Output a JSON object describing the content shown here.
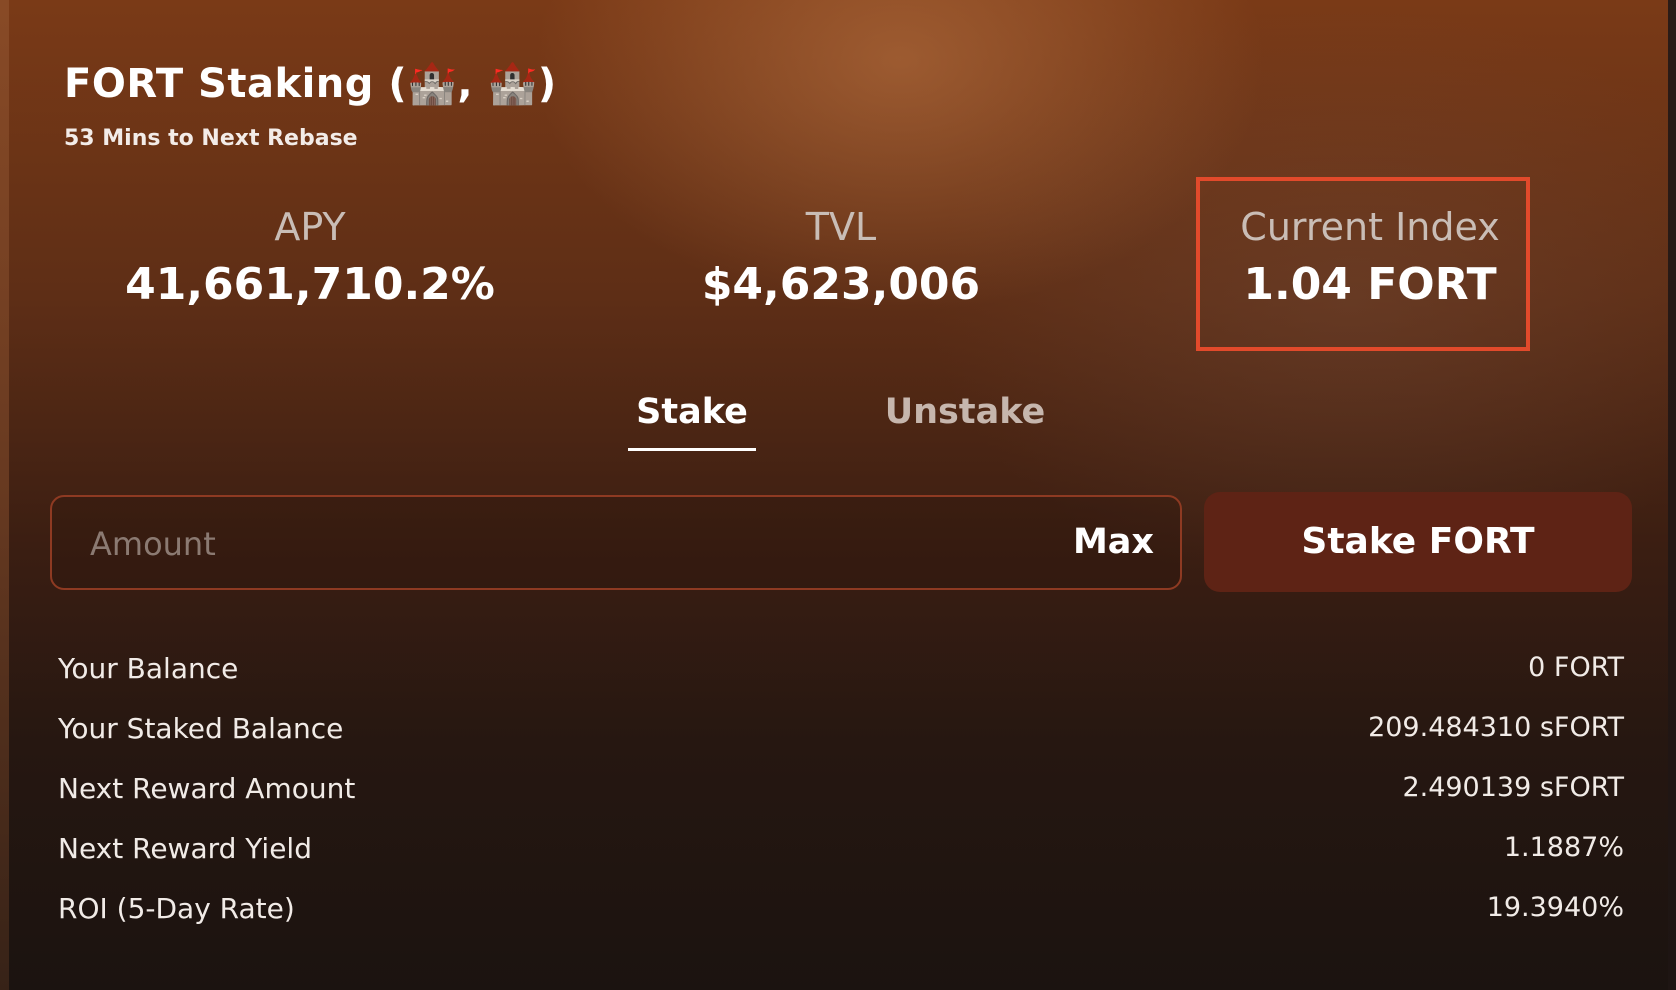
{
  "header": {
    "title": "FORT Staking (🏰, 🏰)",
    "rebase_text": "53 Mins to Next Rebase"
  },
  "stats": [
    {
      "label": "APY",
      "value": "41,661,710.2%"
    },
    {
      "label": "TVL",
      "value": "$4,623,006"
    },
    {
      "label": "Current Index",
      "value": "1.04 FORT"
    }
  ],
  "tabs": [
    {
      "label": "Stake",
      "active": true
    },
    {
      "label": "Unstake",
      "active": false
    }
  ],
  "amount": {
    "placeholder": "Amount",
    "value": "",
    "max_label": "Max"
  },
  "stake_button": {
    "label": "Stake FORT"
  },
  "details": [
    {
      "label": "Your Balance",
      "value": "0 FORT"
    },
    {
      "label": "Your Staked Balance",
      "value": "209.484310 sFORT"
    },
    {
      "label": "Next Reward Amount",
      "value": "2.490139 sFORT"
    },
    {
      "label": "Next Reward Yield",
      "value": "1.1887%"
    },
    {
      "label": "ROI (5-Day Rate)",
      "value": "19.3940%"
    }
  ],
  "colors": {
    "highlight_border": "#e24a2b",
    "button_bg": "#5e2315",
    "input_border": "#8e3a22"
  }
}
